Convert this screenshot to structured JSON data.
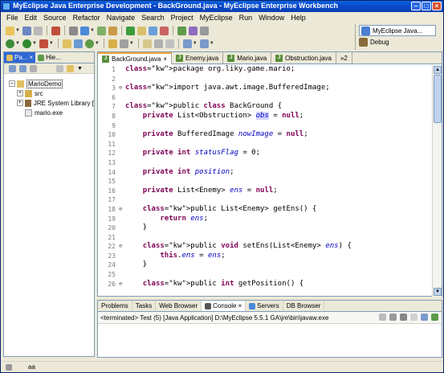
{
  "window": {
    "title": "MyEclipse Java Enterprise Development - BackGround.java - MyEclipse Enterprise Workbench"
  },
  "menu": [
    "File",
    "Edit",
    "Source",
    "Refactor",
    "Navigate",
    "Search",
    "Project",
    "MyEclipse",
    "Run",
    "Window",
    "Help"
  ],
  "perspective": {
    "current": "MyEclipse Java...",
    "other": "Debug"
  },
  "left_panel": {
    "tabs": [
      "Pa...",
      "Hie..."
    ],
    "tree": {
      "project": "MarioDemo",
      "children": [
        "src",
        "JRE System Library [",
        "mario.exe"
      ]
    }
  },
  "editor": {
    "tabs": [
      "BackGround.java",
      "Enemy.java",
      "Mario.java",
      "Obstruction.java"
    ],
    "overflow": "»2",
    "lines": [
      {
        "n": "1",
        "t": "package org.liky.game.mario;"
      },
      {
        "n": "2",
        "t": ""
      },
      {
        "n": "3",
        "t": "import java.awt.image.BufferedImage;"
      },
      {
        "n": "6",
        "t": ""
      },
      {
        "n": "7",
        "t": "public class BackGround {"
      },
      {
        "n": "8",
        "t": "    private List<Obstruction> obs = null;"
      },
      {
        "n": "9",
        "t": ""
      },
      {
        "n": "10",
        "t": "    private BufferedImage nowImage = null;"
      },
      {
        "n": "11",
        "t": ""
      },
      {
        "n": "12",
        "t": "    private int statusFlag = 0;"
      },
      {
        "n": "13",
        "t": ""
      },
      {
        "n": "14",
        "t": "    private int position;"
      },
      {
        "n": "15",
        "t": ""
      },
      {
        "n": "16",
        "t": "    private List<Enemy> ens = null;"
      },
      {
        "n": "17",
        "t": ""
      },
      {
        "n": "18",
        "t": "    public List<Enemy> getEns() {"
      },
      {
        "n": "19",
        "t": "        return ens;"
      },
      {
        "n": "20",
        "t": "    }"
      },
      {
        "n": "21",
        "t": ""
      },
      {
        "n": "22",
        "t": "    public void setEns(List<Enemy> ens) {"
      },
      {
        "n": "23",
        "t": "        this.ens = ens;"
      },
      {
        "n": "24",
        "t": "    }"
      },
      {
        "n": "25",
        "t": ""
      },
      {
        "n": "26",
        "t": "    public int getPosition() {"
      }
    ]
  },
  "bottom_panel": {
    "tabs": [
      "Problems",
      "Tasks",
      "Web Browser",
      "Console",
      "Servers",
      "DB Browser"
    ],
    "console_header": "<terminated> Test (5) [Java Application] D:\\MyEclipse 5.5.1 GA\\jre\\bin\\javaw.exe"
  },
  "status": {
    "text": "aa"
  },
  "colors": {
    "title_blue": "#0a47c8",
    "keyword": "#7f0055",
    "field": "#0000c0",
    "active_tab": "#3167d3"
  }
}
